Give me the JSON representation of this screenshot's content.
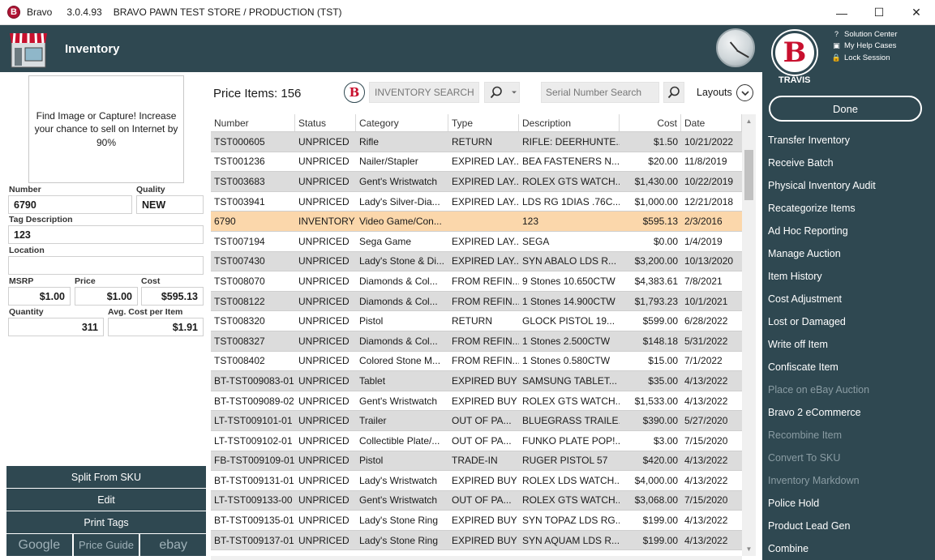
{
  "window": {
    "app_name": "Bravo",
    "version": "3.0.4.93",
    "store": "BRAVO PAWN TEST STORE / PRODUCTION (TST)",
    "minimize": "—",
    "maximize": "☐",
    "close": "✕"
  },
  "header": {
    "title": "Inventory"
  },
  "user": {
    "name": "TRAVIS",
    "logo_letter": "B",
    "links": [
      "Solution Center",
      "My Help Cases",
      "Lock Session"
    ]
  },
  "sidebar": {
    "done": "Done",
    "items": [
      {
        "label": "Transfer Inventory",
        "enabled": true
      },
      {
        "label": "Receive Batch",
        "enabled": true
      },
      {
        "label": "Physical Inventory Audit",
        "enabled": true
      },
      {
        "label": "Recategorize Items",
        "enabled": true
      },
      {
        "label": "Ad Hoc Reporting",
        "enabled": true
      },
      {
        "label": "Manage Auction",
        "enabled": true
      },
      {
        "label": "Item History",
        "enabled": true
      },
      {
        "label": "Cost Adjustment",
        "enabled": true
      },
      {
        "label": "Lost or Damaged",
        "enabled": true
      },
      {
        "label": "Write off Item",
        "enabled": true
      },
      {
        "label": "Confiscate Item",
        "enabled": true
      },
      {
        "label": "Place on eBay Auction",
        "enabled": false
      },
      {
        "label": "Bravo 2 eCommerce",
        "enabled": true
      },
      {
        "label": "Recombine Item",
        "enabled": false
      },
      {
        "label": "Convert To SKU",
        "enabled": false
      },
      {
        "label": "Inventory Markdown",
        "enabled": false
      },
      {
        "label": "Police Hold",
        "enabled": true
      },
      {
        "label": "Product Lead Gen",
        "enabled": true
      },
      {
        "label": "Combine",
        "enabled": true
      }
    ]
  },
  "detail": {
    "image_prompt": "Find Image or Capture! Increase your chance to sell on Internet by 90%",
    "number_label": "Number",
    "number": "6790",
    "quality_label": "Quality",
    "quality": "NEW",
    "tag_desc_label": "Tag Description",
    "tag_desc": "123",
    "location_label": "Location",
    "location": "",
    "msrp_label": "MSRP",
    "msrp": "$1.00",
    "price_label": "Price",
    "price": "$1.00",
    "cost_label": "Cost",
    "cost": "$595.13",
    "quantity_label": "Quantity",
    "quantity": "311",
    "avg_cost_label": "Avg. Cost per Item",
    "avg_cost": "$1.91"
  },
  "left_buttons": {
    "split": "Split From SKU",
    "edit": "Edit",
    "print": "Print Tags",
    "google": "Google",
    "price_guide": "Price Guide",
    "ebay": "ebay"
  },
  "toolbar": {
    "price_items": "Price Items: 156",
    "inventory_search_placeholder": "INVENTORY SEARCH",
    "serial_search_placeholder": "Serial Number Search",
    "layouts": "Layouts"
  },
  "grid": {
    "columns": [
      "Number",
      "Status",
      "Category",
      "Type",
      "Description",
      "Cost",
      "Date"
    ],
    "rows": [
      [
        "TST000605",
        "UNPRICED",
        "Rifle",
        "RETURN",
        "RIFLE: DEERHUNTE...",
        "$1.50",
        "10/21/2022"
      ],
      [
        "TST001236",
        "UNPRICED",
        "Nailer/Stapler",
        "EXPIRED LAY...",
        "BEA FASTENERS N...",
        "$20.00",
        "11/8/2019"
      ],
      [
        "TST003683",
        "UNPRICED",
        "Gent's Wristwatch",
        "EXPIRED LAY...",
        "ROLEX GTS WATCH...",
        "$1,430.00",
        "10/22/2019"
      ],
      [
        "TST003941",
        "UNPRICED",
        "Lady's Silver-Dia...",
        "EXPIRED LAY...",
        "LDS RG 1DIAS .76C...",
        "$1,000.00",
        "12/21/2018"
      ],
      [
        "6790",
        "INVENTORY",
        "Video Game/Con...",
        "",
        "123",
        "$595.13",
        "2/3/2016"
      ],
      [
        "TST007194",
        "UNPRICED",
        "Sega Game",
        "EXPIRED LAY...",
        "SEGA",
        "$0.00",
        "1/4/2019"
      ],
      [
        "TST007430",
        "UNPRICED",
        "Lady's Stone & Di...",
        "EXPIRED LAY...",
        "SYN ABALO LDS R...",
        "$3,200.00",
        "10/13/2020"
      ],
      [
        "TST008070",
        "UNPRICED",
        "Diamonds & Col...",
        "FROM REFIN...",
        "9 Stones 10.650CTW",
        "$4,383.61",
        "7/8/2021"
      ],
      [
        "TST008122",
        "UNPRICED",
        "Diamonds & Col...",
        "FROM REFIN...",
        "1 Stones 14.900CTW",
        "$1,793.23",
        "10/1/2021"
      ],
      [
        "TST008320",
        "UNPRICED",
        "Pistol",
        "RETURN",
        "GLOCK PISTOL 19...",
        "$599.00",
        "6/28/2022"
      ],
      [
        "TST008327",
        "UNPRICED",
        "Diamonds & Col...",
        "FROM REFIN...",
        "1 Stones 2.500CTW",
        "$148.18",
        "5/31/2022"
      ],
      [
        "TST008402",
        "UNPRICED",
        "Colored Stone M...",
        "FROM REFIN...",
        "1 Stones 0.580CTW",
        "$15.00",
        "7/1/2022"
      ],
      [
        "BT-TST009083-01",
        "UNPRICED",
        "Tablet",
        "EXPIRED BUY",
        "SAMSUNG TABLET...",
        "$35.00",
        "4/13/2022"
      ],
      [
        "BT-TST009089-02",
        "UNPRICED",
        "Gent's Wristwatch",
        "EXPIRED BUY",
        "ROLEX GTS WATCH...",
        "$1,533.00",
        "4/13/2022"
      ],
      [
        "LT-TST009101-01",
        "UNPRICED",
        "Trailer",
        "OUT OF PA...",
        "BLUEGRASS TRAILE...",
        "$390.00",
        "5/27/2020"
      ],
      [
        "LT-TST009102-01",
        "UNPRICED",
        "Collectible Plate/...",
        "OUT OF PA...",
        "FUNKO PLATE POP!...",
        "$3.00",
        "7/15/2020"
      ],
      [
        "FB-TST009109-01",
        "UNPRICED",
        "Pistol",
        "TRADE-IN",
        "RUGER PISTOL 57",
        "$420.00",
        "4/13/2022"
      ],
      [
        "BT-TST009131-01",
        "UNPRICED",
        "Lady's Wristwatch",
        "EXPIRED BUY",
        "ROLEX LDS WATCH...",
        "$4,000.00",
        "4/13/2022"
      ],
      [
        "LT-TST009133-00",
        "UNPRICED",
        "Gent's Wristwatch",
        "OUT OF PA...",
        "ROLEX GTS WATCH...",
        "$3,068.00",
        "7/15/2020"
      ],
      [
        "BT-TST009135-01",
        "UNPRICED",
        "Lady's Stone Ring",
        "EXPIRED BUY",
        "SYN TOPAZ LDS RG...",
        "$199.00",
        "4/13/2022"
      ],
      [
        "BT-TST009137-01",
        "UNPRICED",
        "Lady's Stone Ring",
        "EXPIRED BUY",
        "SYN AQUAM LDS R...",
        "$199.00",
        "4/13/2022"
      ]
    ],
    "selected_row": 4
  },
  "colors": {
    "panel": "#2f4851",
    "row_alt": "#dcdcdc",
    "row_selected": "#fbd7ab",
    "brand": "#c8102e"
  }
}
